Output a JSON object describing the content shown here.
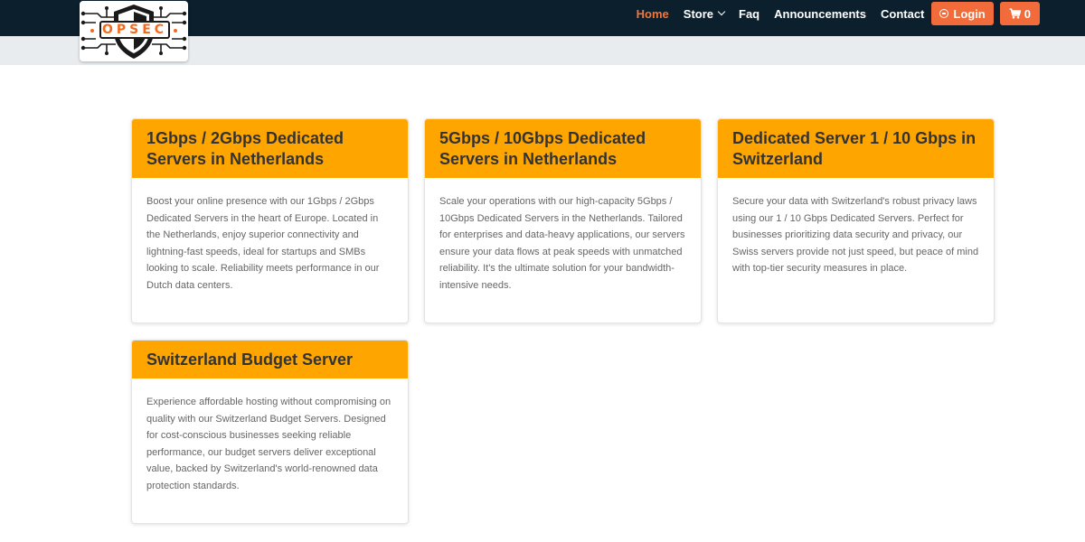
{
  "logo": {
    "text": "OPSEC"
  },
  "nav": {
    "home": "Home",
    "store": "Store",
    "faq": "Faq",
    "announcements": "Announcements",
    "contact": "Contact",
    "login": "Login",
    "cart_count": "0"
  },
  "colors": {
    "topbar": "#0c1f2c",
    "accent": "#f26b3a",
    "card_header": "#ffa500"
  },
  "cards": [
    {
      "title": "1Gbps / 2Gbps Dedicated Servers in Netherlands",
      "description": "Boost your online presence with our 1Gbps / 2Gbps Dedicated Servers in the heart of Europe. Located in the Netherlands, enjoy superior connectivity and lightning-fast speeds, ideal for startups and SMBs looking to scale. Reliability meets performance in our Dutch data centers."
    },
    {
      "title": "5Gbps / 10Gbps Dedicated Servers in Netherlands",
      "description": "Scale your operations with our high-capacity 5Gbps / 10Gbps Dedicated Servers in the Netherlands. Tailored for enterprises and data-heavy applications, our servers ensure your data flows at peak speeds with unmatched reliability. It's the ultimate solution for your bandwidth-intensive needs."
    },
    {
      "title": "Dedicated Server 1 / 10 Gbps in Switzerland",
      "description": "Secure your data with Switzerland's robust privacy laws using our 1 / 10 Gbps Dedicated Servers. Perfect for businesses prioritizing data security and privacy, our Swiss servers provide not just speed, but peace of mind with top-tier security measures in place."
    },
    {
      "title": "Switzerland Budget Server",
      "description": "Experience affordable hosting without compromising on quality with our Switzerland Budget Servers. Designed for cost-conscious businesses seeking reliable performance, our budget servers deliver exceptional value, backed by Switzerland's world-renowned data protection standards."
    }
  ]
}
